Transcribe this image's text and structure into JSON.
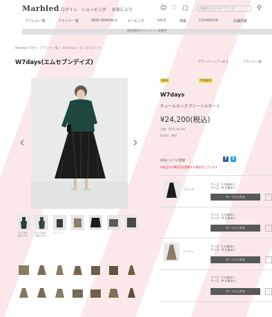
{
  "header": {
    "logo": "Marbled",
    "links": [
      "ログイン",
      "ショッピング",
      "お気に入り"
    ],
    "search_placeholder": "検索したいキーワード"
  },
  "nav": [
    "アパレル一覧",
    "ブランド一覧",
    "NEW ARRIVALS",
    "ランキング",
    "SALE",
    "特集",
    "LOOKBOOK",
    "店舗情報"
  ],
  "banner": "送料無料キャンペーン実施中",
  "breadcrumb": "Marbled TOP > ブランド一覧 > W7days > ロングスカート",
  "page_title": "W7days(エムセブンデイズ)",
  "top_links": [
    "ブランドトップへ戻る",
    "ブランド一覧"
  ],
  "product": {
    "badges": [
      "NEW",
      "予約販売"
    ],
    "brand": "W7days",
    "name": "チュールロングプリーツスカート",
    "price": "¥24,200(税込)",
    "meta": [
      "品番：W7D-SK-001",
      "配送料：無料"
    ],
    "favorite_label": "お気に入りに登録",
    "share": [
      "f",
      "t"
    ],
    "warning": "※商品の在庫状況は変動する場合がございます"
  },
  "thumbs_captions": [
    "モデル着用\n身長163cm",
    "モデル着用\n身長163cm",
    "ディテール",
    "",
    "",
    "",
    ""
  ],
  "variants": [
    {
      "label": "ブラック",
      "stock": "サイズ：S 在庫あり\nサイズ：M 在庫あり",
      "cart": "カートに入れる"
    },
    {
      "label": "",
      "stock": "サイズ：S 在庫あり\nサイズ：M 在庫あり",
      "cart": "カートに入れる"
    },
    {
      "label": "ベージュ",
      "stock": "サイズ：S 在庫あり\nサイズ：M 在庫あり",
      "cart": "カートに入れる"
    },
    {
      "label": "",
      "stock": "サイズ：S 在庫あり\nサイズ：M 在庫あり",
      "cart": "カートに入れる"
    }
  ],
  "colors": {
    "badge": "#efd844",
    "cart": "#58595b",
    "facebook": "#3b5998",
    "twitter": "#1da1f2",
    "warning": "#dd3333",
    "accent_stripe": "#fbe9ea"
  }
}
